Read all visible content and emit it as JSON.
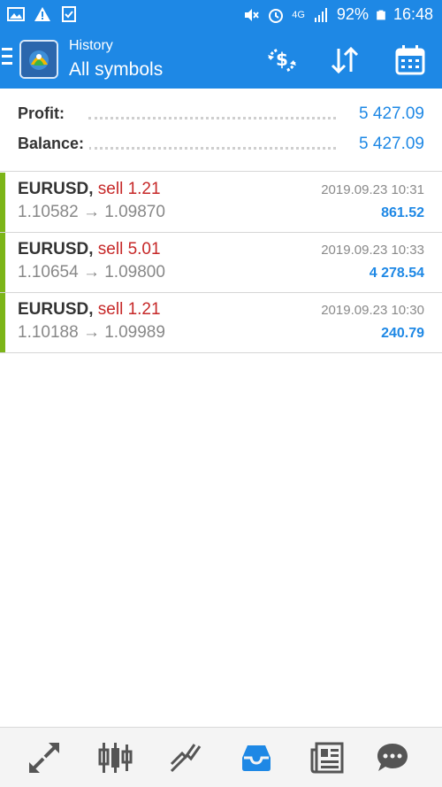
{
  "status_bar": {
    "battery": "92%",
    "time": "16:48",
    "network": "4G"
  },
  "header": {
    "title_small": "History",
    "title_big": "All symbols"
  },
  "summary": {
    "profit_label": "Profit:",
    "profit_value": "5 427.09",
    "balance_label": "Balance:",
    "balance_value": "5 427.09"
  },
  "deals": [
    {
      "symbol": "EURUSD,",
      "side": "sell 1.21",
      "prices": "1.10582 → 1.09870",
      "time": "2019.09.23 10:31",
      "profit": "861.52"
    },
    {
      "symbol": "EURUSD,",
      "side": "sell 5.01",
      "prices": "1.10654 → 1.09800",
      "time": "2019.09.23 10:33",
      "profit": "4 278.54"
    },
    {
      "symbol": "EURUSD,",
      "side": "sell 1.21",
      "prices": "1.10188 → 1.09989",
      "time": "2019.09.23 10:30",
      "profit": "240.79"
    }
  ],
  "colors": {
    "accent": "#1e88e5",
    "sell": "#c62828",
    "profit_bar": "#7cb518",
    "nav_icon": "#555555",
    "nav_active": "#1e88e5"
  },
  "icons": {
    "header": [
      "currency-exchange-icon",
      "sort-icon",
      "calendar-icon"
    ],
    "nav": [
      "quotes-icon",
      "chart-icon",
      "trade-icon",
      "history-icon",
      "news-icon",
      "chat-icon"
    ]
  }
}
